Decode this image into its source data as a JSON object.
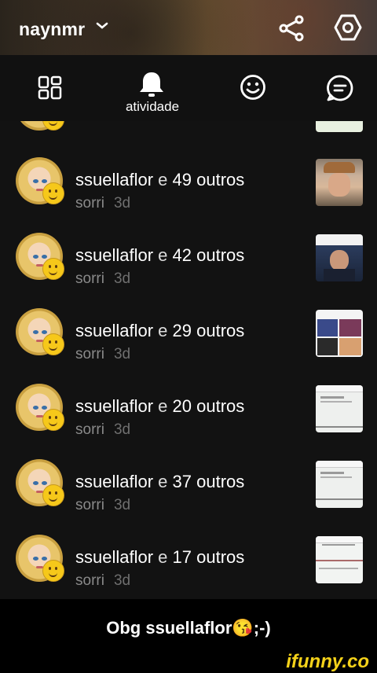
{
  "header": {
    "username": "naynmr",
    "icons": [
      "chevron-down-icon",
      "share-icon",
      "settings-icon"
    ]
  },
  "tabs": [
    {
      "icon": "grid-icon",
      "label": ""
    },
    {
      "icon": "bell-icon",
      "label": "atividade"
    },
    {
      "icon": "smiley-icon",
      "label": ""
    },
    {
      "icon": "chat-icon",
      "label": ""
    }
  ],
  "rows": [
    {
      "user": "ssuellaflor",
      "conj": "e",
      "others": "49 outros",
      "action": "sorri",
      "time": "3d",
      "thumb": "selfie-photo"
    },
    {
      "user": "ssuellaflor",
      "conj": "e",
      "others": "42 outros",
      "action": "sorri",
      "time": "3d",
      "thumb": "news-photo"
    },
    {
      "user": "ssuellaflor",
      "conj": "e",
      "others": "29 outros",
      "action": "sorri",
      "time": "3d",
      "thumb": "meme-collage"
    },
    {
      "user": "ssuellaflor",
      "conj": "e",
      "others": "20 outros",
      "action": "sorri",
      "time": "3d",
      "thumb": "chat-screenshot"
    },
    {
      "user": "ssuellaflor",
      "conj": "e",
      "others": "37 outros",
      "action": "sorri",
      "time": "3d",
      "thumb": "chat-screenshot"
    },
    {
      "user": "ssuellaflor",
      "conj": "e",
      "others": "17 outros",
      "action": "sorri",
      "time": "3d",
      "thumb": "chat-screenshot"
    }
  ],
  "caption": "Obg ssuellaflor😘;-)",
  "watermark": "ifunny.co",
  "colors": {
    "accent": "#f6c81a",
    "background": "#121212",
    "muted": "#8a8a8a"
  }
}
